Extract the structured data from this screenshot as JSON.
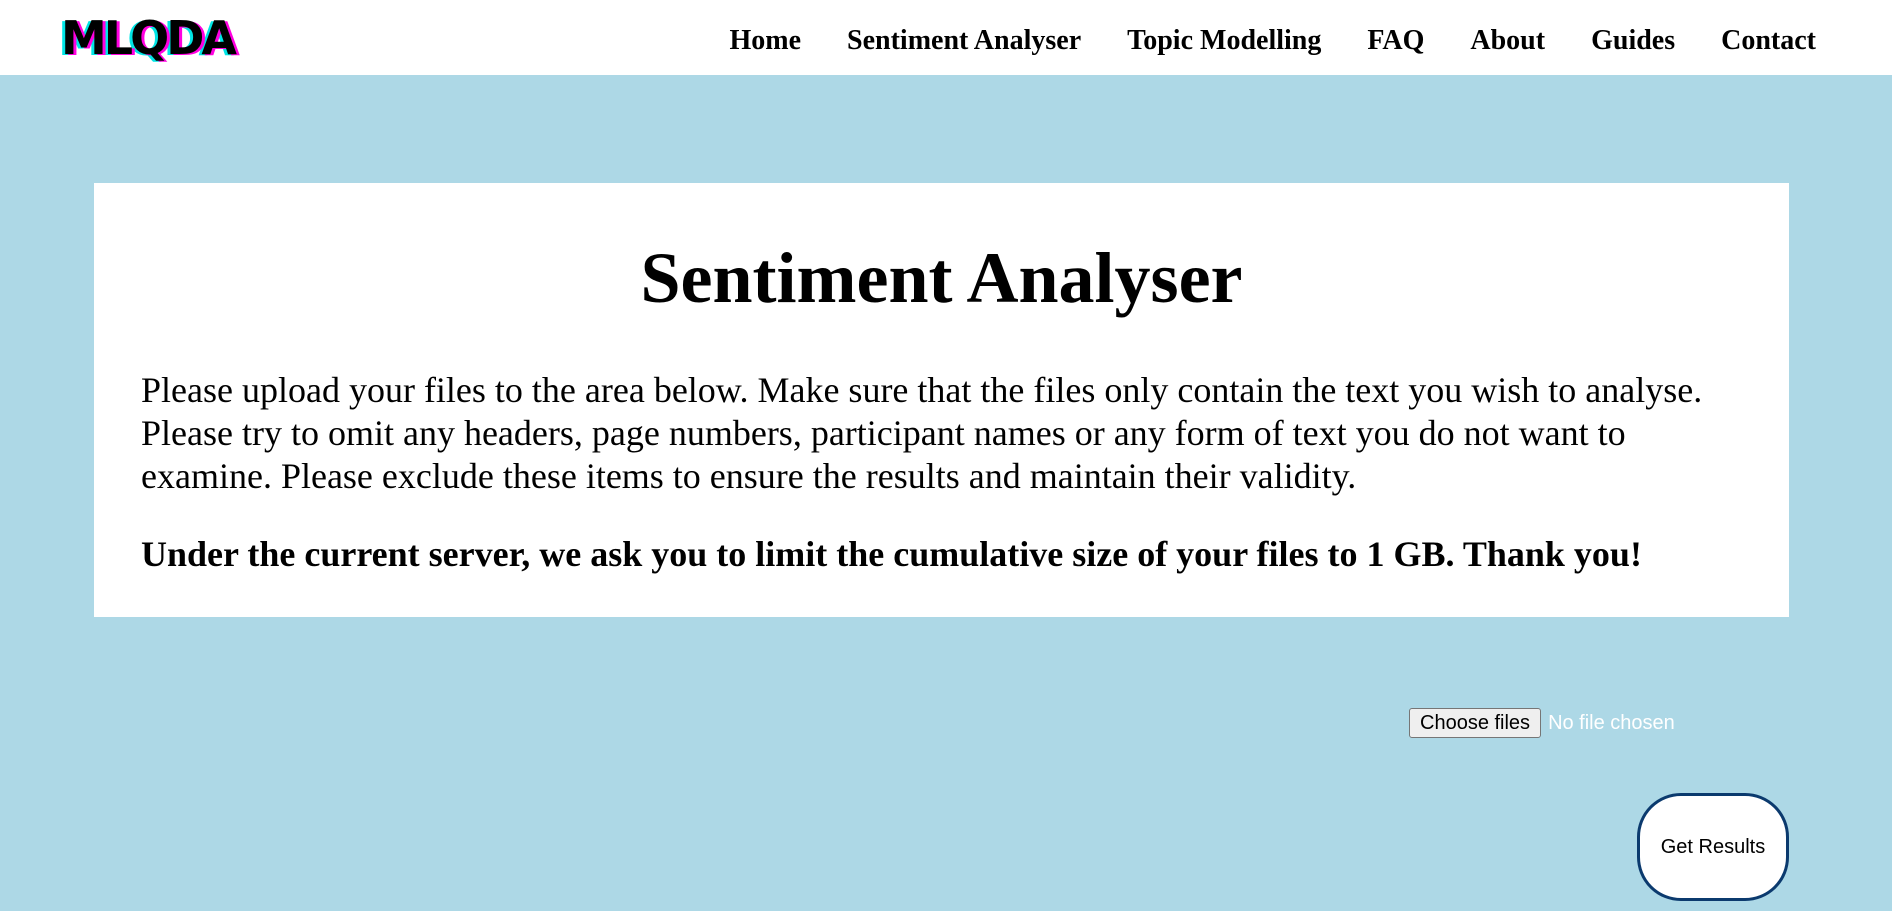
{
  "brand": {
    "logo_text": "MLQDA"
  },
  "nav": {
    "items": [
      {
        "label": "Home"
      },
      {
        "label": "Sentiment Analyser"
      },
      {
        "label": "Topic Modelling"
      },
      {
        "label": "FAQ"
      },
      {
        "label": "About"
      },
      {
        "label": "Guides"
      },
      {
        "label": "Contact"
      }
    ]
  },
  "main": {
    "title": "Sentiment Analyser",
    "intro": "Please upload your files to the area below. Make sure that the files only contain the text you wish to analyse. Please try to omit any headers, page numbers, participant names or any form of text you do not want to examine. Please exclude these items to ensure the results and maintain their validity.",
    "notice": "Under the current server, we ask you to limit the cumulative size of your files to 1 GB. Thank you!"
  },
  "upload": {
    "button_label": "Choose files",
    "status": "No file chosen"
  },
  "actions": {
    "get_results_label": "Get Results"
  },
  "colors": {
    "page_background": "#add8e6",
    "button_border": "#0b3a6e",
    "logo_cyan": "#00e5e5",
    "logo_magenta": "#ff00e0"
  }
}
